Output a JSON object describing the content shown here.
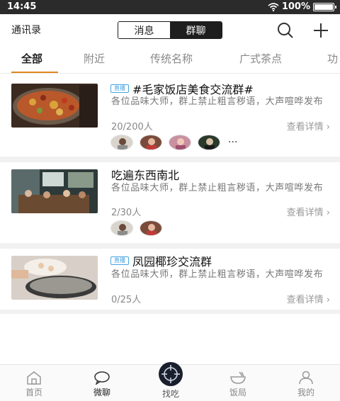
{
  "status_bar": {
    "time": "14:45",
    "battery": "100%",
    "battery_level": 1.0
  },
  "top_nav": {
    "contacts": "通讯录",
    "segments": [
      {
        "label": "消息",
        "active": false
      },
      {
        "label": "群聊",
        "active": true
      }
    ],
    "icons": [
      "search-icon",
      "plus-icon"
    ]
  },
  "tabs": [
    {
      "label": "全部",
      "active": true
    },
    {
      "label": "附近",
      "active": false
    },
    {
      "label": "传统名称",
      "active": false
    },
    {
      "label": "广式茶点",
      "active": false
    },
    {
      "label": "功",
      "active": false
    }
  ],
  "groups": [
    {
      "live_badge": "直播",
      "title": "#毛家饭店美食交流群#",
      "description": "各位品味大师，群上禁止粗言秽语，大声喧哗发布",
      "members": "20/200人",
      "details": "查看详情",
      "avatar_count": 4,
      "more": "···"
    },
    {
      "live_badge": "",
      "title": "吃遍东西南北",
      "description": "各位品味大师，群上禁止粗言秽语，大声喧哗发布",
      "members": "2/30人",
      "details": "查看详情",
      "avatar_count": 2,
      "more": ""
    },
    {
      "live_badge": "直播",
      "title": "凤园椰珍交流群",
      "description": "各位品味大师，群上禁止粗言秽语，大声喧哗发布",
      "members": "0/25人",
      "details": "查看详情",
      "avatar_count": 0,
      "more": ""
    }
  ],
  "bottom_nav": [
    {
      "label": "首页",
      "icon": "home-icon",
      "active": false
    },
    {
      "label": "微聊",
      "icon": "chat-bubble-icon",
      "active": true
    },
    {
      "label": "找吃",
      "icon": "crosshair-icon",
      "active": false
    },
    {
      "label": "饭局",
      "icon": "bowl-icon",
      "active": false
    },
    {
      "label": "我的",
      "icon": "person-icon",
      "active": false
    }
  ],
  "colors": {
    "accent": "#e0871f",
    "badge": "#47a3e0",
    "dark": "#1e1e1e"
  }
}
